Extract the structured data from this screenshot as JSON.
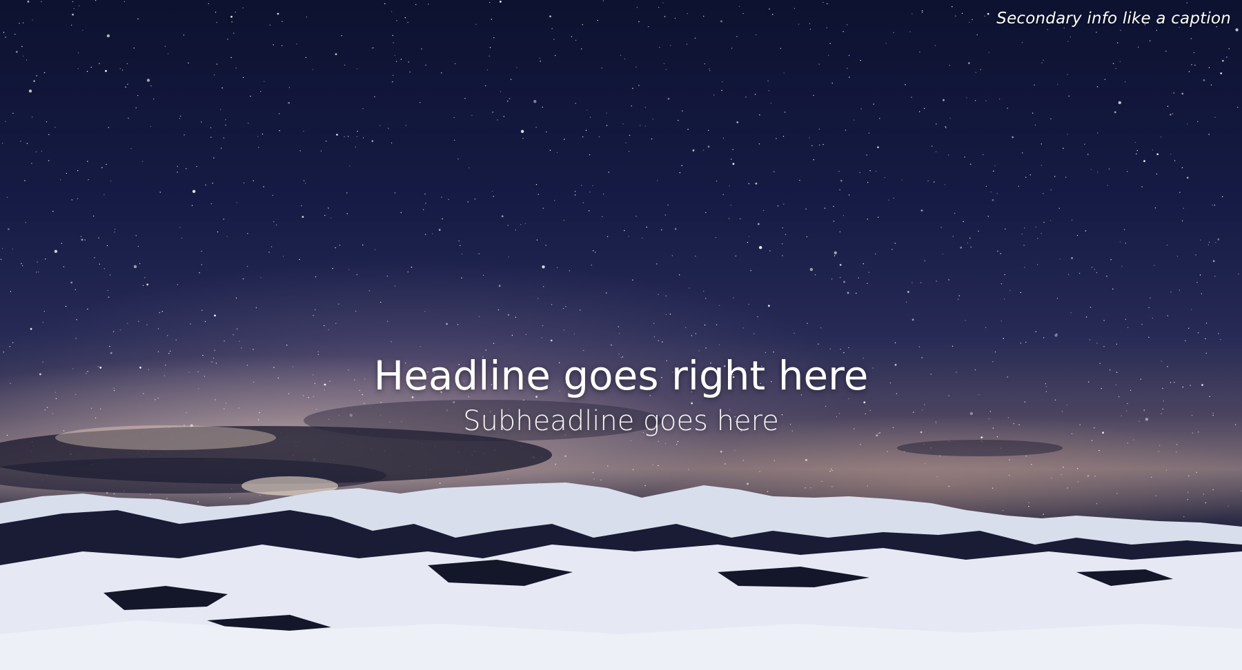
{
  "hero": {
    "caption": "Secondary info like a caption",
    "headline": "Headline goes right here",
    "subheadline": "Subheadline goes here"
  },
  "colors": {
    "sky_top": "#0d1230",
    "sky_mid": "#262a55",
    "horizon_glow": "#e6cdbe",
    "snow": "#e9ecf5",
    "shadow": "#0a0c1f",
    "text": "#ffffff"
  }
}
